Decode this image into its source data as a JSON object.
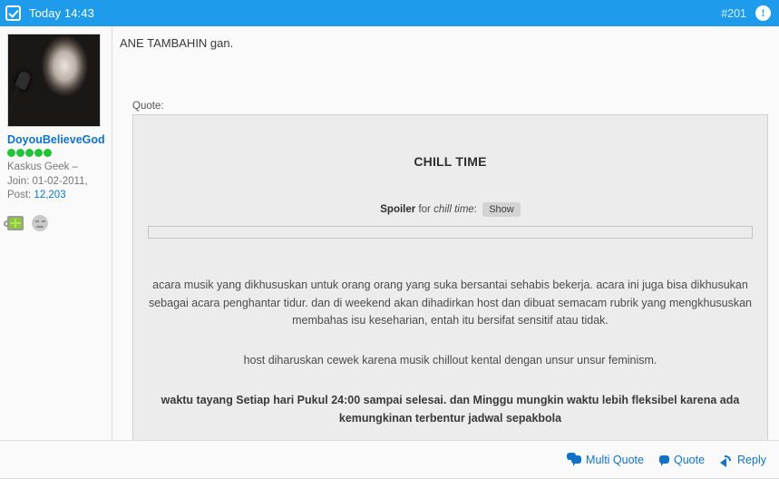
{
  "header": {
    "checkbox_icon": "checkbox-checked-icon",
    "timestamp": "Today 14:43",
    "post_number": "#201",
    "report_icon": "exclamation-circle-icon",
    "background_color": "#1e9ceb"
  },
  "user": {
    "avatar_alt": "black and white photo of woman singing into microphone",
    "username": "DoyouBelieveGod",
    "rating_dots": 5,
    "rating_color": "#22c336",
    "title": "Kaskus Geek –",
    "join": "Join: 01-02-2011,",
    "post_label": "Post:",
    "post_count": "12,203",
    "badges": [
      {
        "icon": "green-mug-icon",
        "name": "reputation-mug"
      },
      {
        "icon": "gray-smiley-icon",
        "name": "award-smiley"
      }
    ]
  },
  "post": {
    "intro": "ANE TAMBAHIN gan.",
    "quote_label": "Quote:"
  },
  "quote": {
    "title": "CHILL TIME",
    "spoiler_prefix": "Spoiler",
    "spoiler_middle": "for",
    "spoiler_subject": "chill time",
    "spoiler_suffix": ":",
    "show_button": "Show",
    "paragraph_1": "acara musik yang dikhususkan untuk orang orang yang suka bersantai sehabis bekerja. acara ini juga bisa dikhusukan sebagai acara penghantar tidur. dan di weekend akan dihadirkan host dan dibuat semacam rubrik yang mengkhususkan membahas isu keseharian, entah itu bersifat sensitif atau tidak.",
    "paragraph_2": "host diharuskan cewek karena musik chillout kental dengan unsur unsur feminism.",
    "paragraph_bold": "waktu tayang Setiap hari Pukul 24:00 sampai selesai. dan Minggu mungkin waktu lebih fleksibel karena ada kemungkinan terbentur jadwal sepakbola",
    "background_color": "#ececec"
  },
  "footer": {
    "multi_quote": "Multi Quote",
    "quote": "Quote",
    "reply": "Reply",
    "link_color": "#1273c6"
  }
}
